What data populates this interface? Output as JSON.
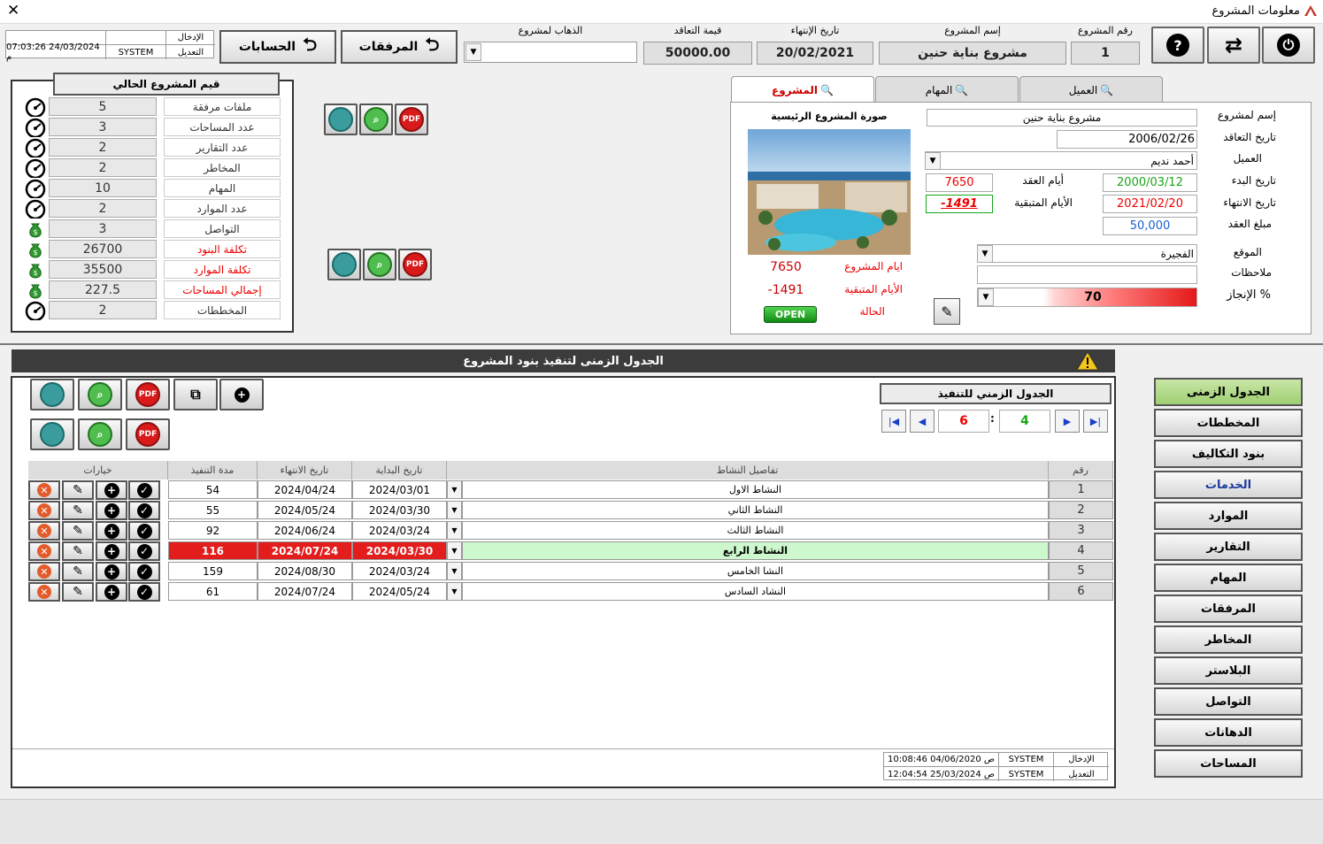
{
  "window": {
    "title": "معلومات المشروع",
    "close": "✕"
  },
  "header": {
    "project_no_label": "رقم المشروع",
    "project_no": "1",
    "project_name_label": "إسم المشروع",
    "project_name": "مشروع بناية حنين",
    "end_date_label": "تاريخ الإنتهاء",
    "end_date": "20/02/2021",
    "contract_value_label": "قيمة التعاقد",
    "contract_value": "50000.00",
    "goto_label": "الذهاب لمشروع",
    "attachments_btn": "المرفقات",
    "accounts_btn": "الحسابات",
    "audit": {
      "entry_label": "الإدخال",
      "edit_label": "التعديل",
      "user": "SYSTEM",
      "datetime": "07:03:26 24/03/2024 م"
    }
  },
  "summary": {
    "title": "قيم المشروع الحالي",
    "rows": [
      {
        "label": "ملفات مرفقة",
        "value": "5",
        "red": false,
        "icon": "gauge-icon"
      },
      {
        "label": "عدد المساحات",
        "value": "3",
        "red": false,
        "icon": "gauge-icon"
      },
      {
        "label": "عدد التقارير",
        "value": "2",
        "red": false,
        "icon": "gauge-icon"
      },
      {
        "label": "المخاطر",
        "value": "2",
        "red": false,
        "icon": "gauge-icon"
      },
      {
        "label": "المهام",
        "value": "10",
        "red": false,
        "icon": "gauge-icon"
      },
      {
        "label": "عدد الموارد",
        "value": "2",
        "red": false,
        "icon": "gauge-icon"
      },
      {
        "label": "التواصل",
        "value": "3",
        "red": false,
        "icon": "money-bag-icon"
      },
      {
        "label": "تكلفة البنود",
        "value": "26700",
        "red": true,
        "icon": "money-bag-icon"
      },
      {
        "label": "تكلفة الموارد",
        "value": "35500",
        "red": true,
        "icon": "money-bag-icon"
      },
      {
        "label": "إجمالي المساحات",
        "value": "227.5",
        "red": true,
        "icon": "money-bag-icon"
      },
      {
        "label": "المخططات",
        "value": "2",
        "red": false,
        "icon": "gauge-icon"
      }
    ]
  },
  "pdf_label": "PDF",
  "tabs": [
    {
      "label": "المشروع",
      "active": true
    },
    {
      "label": "المهام",
      "active": false
    },
    {
      "label": "العميل",
      "active": false
    }
  ],
  "project": {
    "photo_title": "صورة المشروع الرئيسية",
    "name_label": "إسم لمشروع",
    "name": "مشروع بناية حنين",
    "contract_date_label": "تاريخ التعاقد",
    "contract_date": "2006/02/26",
    "client_label": "العميل",
    "client": "أحمد نديم",
    "start_label": "تاريخ البدء",
    "start": "2000/03/12",
    "end_label": "تاريخ الانتهاء",
    "end": "2021/02/20",
    "amount_label": "مبلغ العقد",
    "amount": "50,000",
    "contract_days_label": "أيام العقد",
    "contract_days": "7650",
    "remaining_label": "الأيام المتبقية",
    "remaining": "-1491",
    "location_label": "الموقع",
    "location": "الفجيرة",
    "notes_label": "ملاحظات",
    "notes": "",
    "progress_label": "الإنجاز %",
    "progress": "70",
    "proj_days_label": "ايام المشروع",
    "proj_days": "7650",
    "proj_remaining_label": "الأيام المتبقية",
    "proj_remaining": "-1491",
    "status_label": "الحالة",
    "status": "OPEN"
  },
  "schedule": {
    "banner": "الجدول الزمنى لتنفيذ بنود المشروع",
    "subtitle": "الجدول الزمني للتنفيذ",
    "page_current": "4",
    "page_total": "6",
    "page_sep": ":",
    "cols": {
      "no": "رقم",
      "details": "تفاصيل النشاط",
      "start": "تاريخ البداية",
      "end": "تاريخ الانتهاء",
      "duration": "مدة التنفيذ",
      "options": "خيارات"
    },
    "rows": [
      {
        "no": "1",
        "details": "النشاط الاول",
        "start": "2024/03/01",
        "end": "2024/04/24",
        "dur": "54",
        "hl": false
      },
      {
        "no": "2",
        "details": "النشاط الثاني",
        "start": "2024/03/30",
        "end": "2024/05/24",
        "dur": "55",
        "hl": false
      },
      {
        "no": "3",
        "details": "النشاط الثالث",
        "start": "2024/03/24",
        "end": "2024/06/24",
        "dur": "92",
        "hl": false
      },
      {
        "no": "4",
        "details": "النشاط الرابع",
        "start": "2024/03/30",
        "end": "2024/07/24",
        "dur": "116",
        "hl": true
      },
      {
        "no": "5",
        "details": "النشا الخامس",
        "start": "2024/03/24",
        "end": "2024/08/30",
        "dur": "159",
        "hl": false
      },
      {
        "no": "6",
        "details": "النشاد السادس",
        "start": "2024/05/24",
        "end": "2024/07/24",
        "dur": "61",
        "hl": false
      }
    ],
    "audit": {
      "entry_label": "الإدخال",
      "edit_label": "التعديل",
      "user1": "SYSTEM",
      "dt1": "10:08:46 04/06/2020 ص",
      "user2": "SYSTEM",
      "dt2": "12:04:54 25/03/2024 ص"
    }
  },
  "sidebar": [
    "الجدول الزمنى",
    "المخططات",
    "بنود التكاليف",
    "الخدمات",
    "الموارد",
    "التقارير",
    "المهام",
    "المرفقات",
    "المخاطر",
    "البلاستر",
    "التواصل",
    "الدهانات",
    "المساحات"
  ]
}
